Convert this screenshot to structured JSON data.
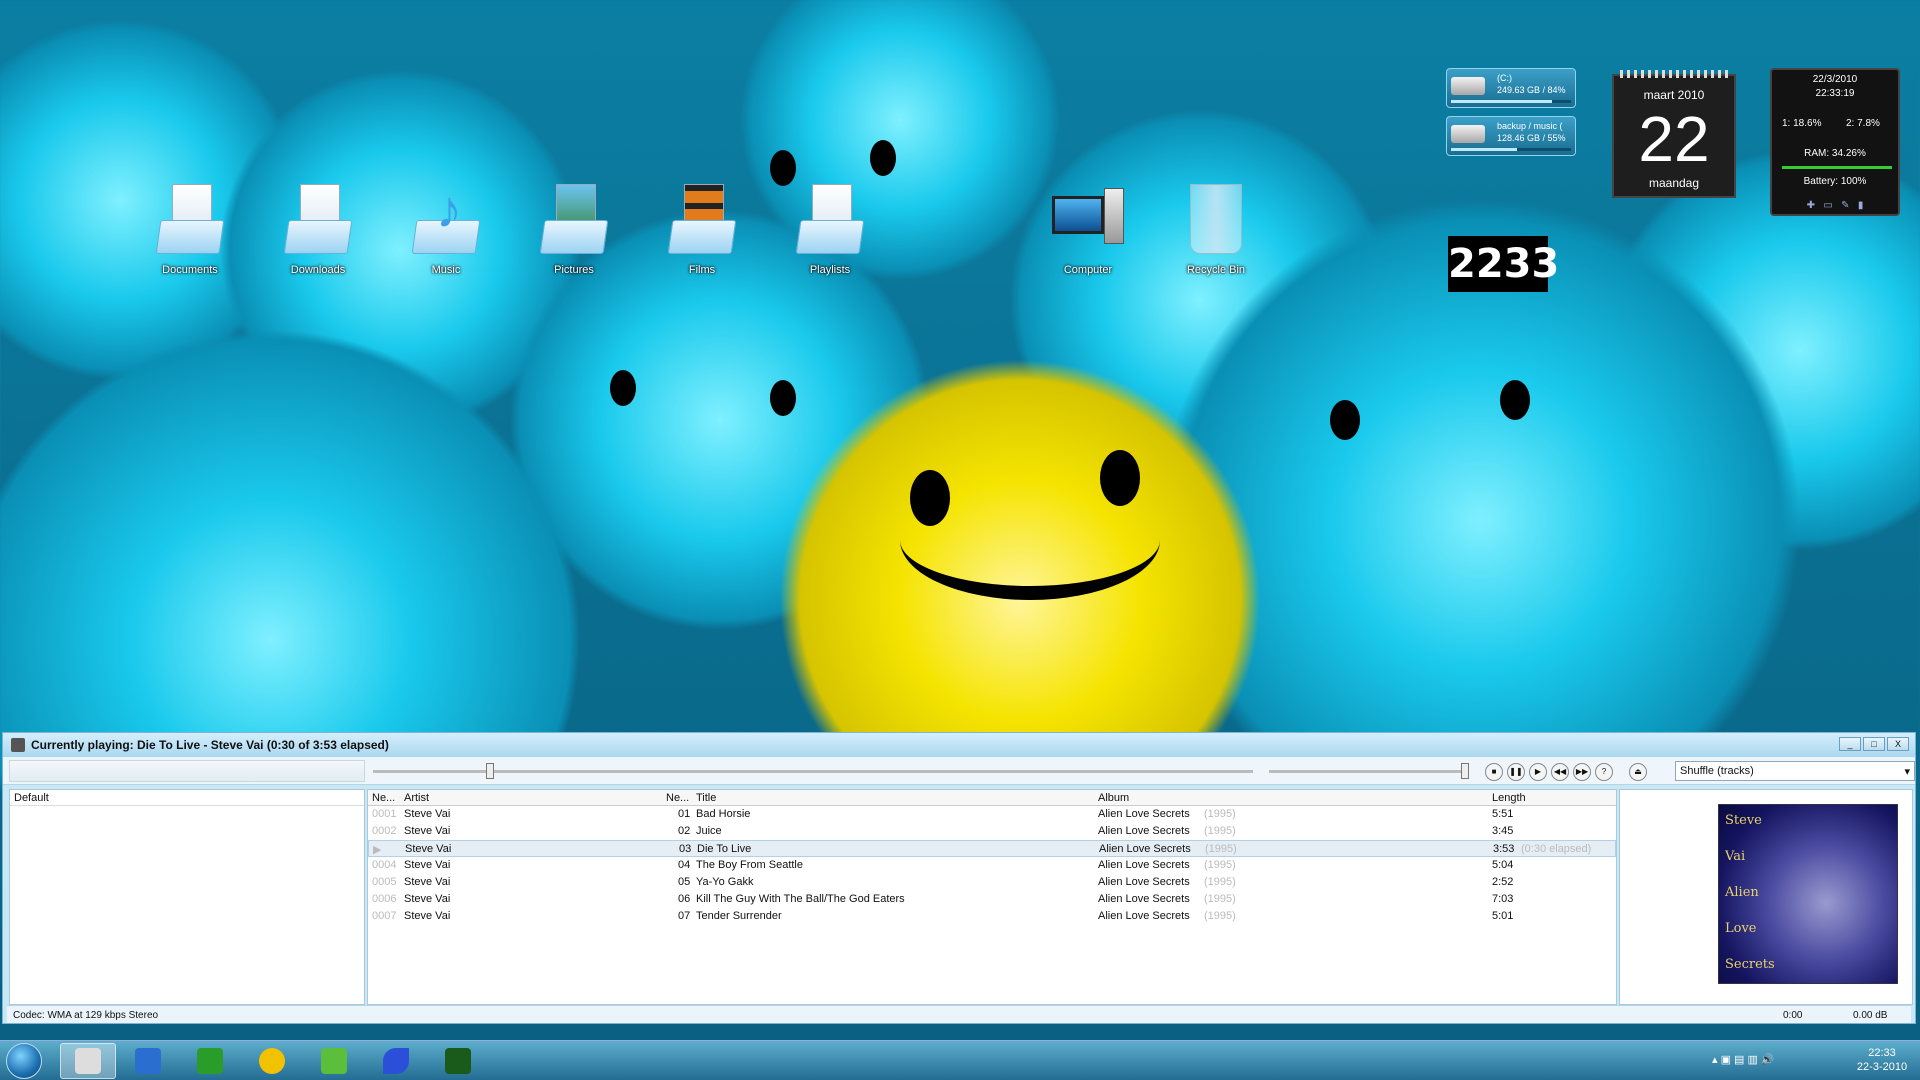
{
  "desktop": {
    "icons": [
      {
        "label": "Documents",
        "icon": "documents-library-icon"
      },
      {
        "label": "Downloads",
        "icon": "downloads-folder-icon"
      },
      {
        "label": "Music",
        "icon": "music-library-icon"
      },
      {
        "label": "Pictures",
        "icon": "pictures-library-icon"
      },
      {
        "label": "Films",
        "icon": "films-folder-icon"
      },
      {
        "label": "Playlists",
        "icon": "playlists-folder-icon"
      },
      {
        "label": "Computer",
        "icon": "computer-icon"
      },
      {
        "label": "Recycle Bin",
        "icon": "recycle-bin-icon"
      }
    ]
  },
  "gadgets": {
    "drives": [
      {
        "name": "(C:)",
        "info": "249.63 GB / 84%",
        "used_percent": 84
      },
      {
        "name": "backup / music (",
        "info": "128.46 GB / 55%",
        "used_percent": 55
      }
    ],
    "calendar": {
      "month": "maart 2010",
      "day": "22",
      "weekday": "maandag"
    },
    "flip_clock": "2233",
    "system_monitor": {
      "date": "22/3/2010",
      "time": "22:33:19",
      "cpu1": "1: 18.6%",
      "cpu2": "2: 7.8%",
      "ram": "RAM: 34.26%",
      "battery": "Battery: 100%"
    }
  },
  "player": {
    "title": "Currently playing: Die To Live - Steve Vai (0:30 of 3:53 elapsed)",
    "window_buttons": [
      "_",
      "□",
      "X"
    ],
    "order": "Shuffle (tracks)",
    "seek_fraction": 0.128,
    "volume_fraction": 1.0,
    "controls": [
      "stop",
      "pause",
      "play",
      "previous",
      "next",
      "random"
    ],
    "playlists": [
      "Default"
    ],
    "columns": {
      "num": "Ne...",
      "artist": "Artist",
      "track": "Ne...",
      "title": "Title",
      "album": "Album",
      "length": "Length"
    },
    "tracks": [
      {
        "num": "0001",
        "artist": "Steve Vai",
        "track": "01",
        "title": "Bad Horsie",
        "album": "Alien Love Secrets",
        "year": "(1995)",
        "length": "5:51",
        "extra": ""
      },
      {
        "num": "0002",
        "artist": "Steve Vai",
        "track": "02",
        "title": "Juice",
        "album": "Alien Love Secrets",
        "year": "(1995)",
        "length": "3:45",
        "extra": ""
      },
      {
        "num": "▶",
        "artist": "Steve Vai",
        "track": "03",
        "title": "Die To Live",
        "album": "Alien Love Secrets",
        "year": "(1995)",
        "length": "3:53",
        "extra": "(0:30 elapsed)"
      },
      {
        "num": "0004",
        "artist": "Steve Vai",
        "track": "04",
        "title": "The Boy From Seattle",
        "album": "Alien Love Secrets",
        "year": "(1995)",
        "length": "5:04",
        "extra": ""
      },
      {
        "num": "0005",
        "artist": "Steve Vai",
        "track": "05",
        "title": "Ya-Yo Gakk",
        "album": "Alien Love Secrets",
        "year": "(1995)",
        "length": "2:52",
        "extra": ""
      },
      {
        "num": "0006",
        "artist": "Steve Vai",
        "track": "06",
        "title": "Kill The Guy With The Ball/The God Eaters",
        "album": "Alien Love Secrets",
        "year": "(1995)",
        "length": "7:03",
        "extra": ""
      },
      {
        "num": "0007",
        "artist": "Steve Vai",
        "track": "07",
        "title": "Tender Surrender",
        "album": "Alien Love Secrets",
        "year": "(1995)",
        "length": "5:01",
        "extra": ""
      }
    ],
    "cover_text": [
      "Steve",
      "Vai",
      "Alien",
      "Love",
      "Secrets"
    ],
    "status": {
      "codec": "Codec: WMA at 129 kbps Stereo",
      "time": "0:00",
      "gain": "0.00 dB"
    }
  },
  "taskbar": {
    "apps": [
      "foobar2000",
      "media-player",
      "utorrent",
      "messenger",
      "network-share",
      "bird-app",
      "equalizer-app"
    ],
    "clock_time": "22:33",
    "clock_date": "22-3-2010"
  }
}
